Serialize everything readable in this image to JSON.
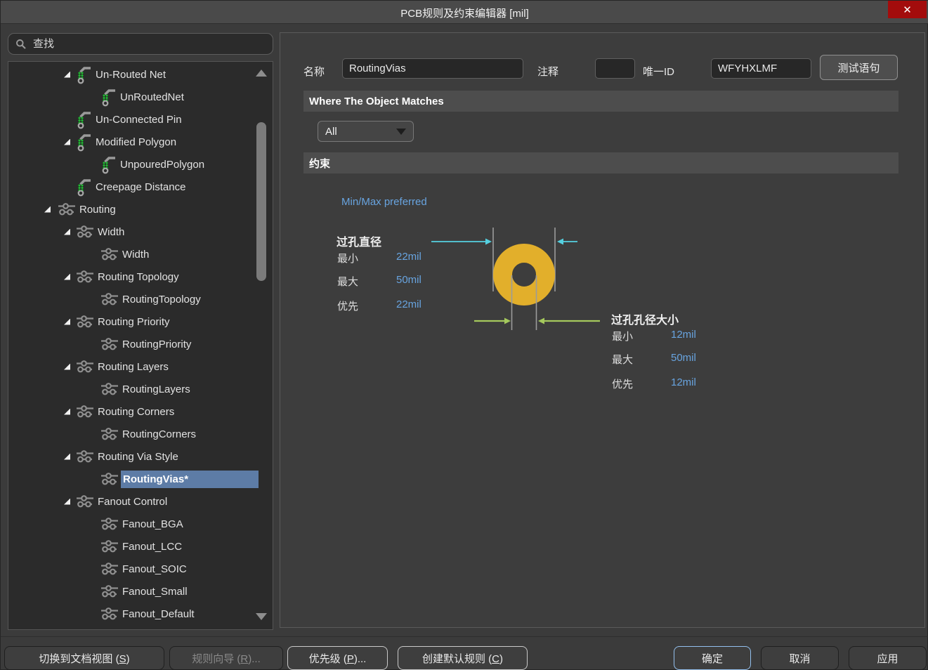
{
  "window": {
    "title": "PCB规则及约束编辑器 [mil]",
    "close_icon": "✕"
  },
  "search": {
    "placeholder": "查找"
  },
  "tree": {
    "items": [
      {
        "label": "Un-Routed Net",
        "level": 2,
        "icon": "electrical-rule-icon",
        "expander": true,
        "selected": false
      },
      {
        "label": "UnRoutedNet",
        "level": 3,
        "icon": "electrical-rule-icon",
        "expander": false,
        "selected": false
      },
      {
        "label": "Un-Connected Pin",
        "level": 2,
        "icon": "electrical-rule-icon",
        "expander": false,
        "selected": false
      },
      {
        "label": "Modified Polygon",
        "level": 2,
        "icon": "electrical-rule-icon",
        "expander": true,
        "selected": false
      },
      {
        "label": "UnpouredPolygon",
        "level": 3,
        "icon": "electrical-rule-icon",
        "expander": false,
        "selected": false
      },
      {
        "label": "Creepage Distance",
        "level": 2,
        "icon": "electrical-rule-icon",
        "expander": false,
        "selected": false
      },
      {
        "label": "Routing",
        "level": 1,
        "icon": "routing-rule-icon",
        "expander": true,
        "selected": false
      },
      {
        "label": "Width",
        "level": 2,
        "icon": "routing-rule-icon",
        "expander": true,
        "selected": false
      },
      {
        "label": "Width",
        "level": 3,
        "icon": "routing-rule-icon",
        "expander": false,
        "selected": false
      },
      {
        "label": "Routing Topology",
        "level": 2,
        "icon": "routing-rule-icon",
        "expander": true,
        "selected": false
      },
      {
        "label": "RoutingTopology",
        "level": 3,
        "icon": "routing-rule-icon",
        "expander": false,
        "selected": false
      },
      {
        "label": "Routing Priority",
        "level": 2,
        "icon": "routing-rule-icon",
        "expander": true,
        "selected": false
      },
      {
        "label": "RoutingPriority",
        "level": 3,
        "icon": "routing-rule-icon",
        "expander": false,
        "selected": false
      },
      {
        "label": "Routing Layers",
        "level": 2,
        "icon": "routing-rule-icon",
        "expander": true,
        "selected": false
      },
      {
        "label": "RoutingLayers",
        "level": 3,
        "icon": "routing-rule-icon",
        "expander": false,
        "selected": false
      },
      {
        "label": "Routing Corners",
        "level": 2,
        "icon": "routing-rule-icon",
        "expander": true,
        "selected": false
      },
      {
        "label": "RoutingCorners",
        "level": 3,
        "icon": "routing-rule-icon",
        "expander": false,
        "selected": false
      },
      {
        "label": "Routing Via Style",
        "level": 2,
        "icon": "routing-rule-icon",
        "expander": true,
        "selected": false
      },
      {
        "label": "RoutingVias*",
        "level": 3,
        "icon": "routing-rule-icon",
        "expander": false,
        "selected": true
      },
      {
        "label": "Fanout Control",
        "level": 2,
        "icon": "routing-rule-icon",
        "expander": true,
        "selected": false
      },
      {
        "label": "Fanout_BGA",
        "level": 3,
        "icon": "routing-rule-icon",
        "expander": false,
        "selected": false
      },
      {
        "label": "Fanout_LCC",
        "level": 3,
        "icon": "routing-rule-icon",
        "expander": false,
        "selected": false
      },
      {
        "label": "Fanout_SOIC",
        "level": 3,
        "icon": "routing-rule-icon",
        "expander": false,
        "selected": false
      },
      {
        "label": "Fanout_Small",
        "level": 3,
        "icon": "routing-rule-icon",
        "expander": false,
        "selected": false
      },
      {
        "label": "Fanout_Default",
        "level": 3,
        "icon": "routing-rule-icon",
        "expander": false,
        "selected": false
      }
    ]
  },
  "rule_header": {
    "name_label": "名称",
    "name_value": "RoutingVias",
    "comment_label": "注释",
    "comment_value": "",
    "uid_label": "唯一ID",
    "uid_value": "WFYHXLMF",
    "test_query_button": "测试语句"
  },
  "match_section": {
    "title": "Where The Object Matches",
    "scope_value": "All"
  },
  "constraints": {
    "title": "约束",
    "mode_note": "Min/Max preferred",
    "via_diameter": {
      "title": "过孔直径",
      "rows": [
        {
          "label": "最小",
          "value": "22mil"
        },
        {
          "label": "最大",
          "value": "50mil"
        },
        {
          "label": "优先",
          "value": "22mil"
        }
      ]
    },
    "hole_size": {
      "title": "过孔孔径大小",
      "rows": [
        {
          "label": "最小",
          "value": "12mil"
        },
        {
          "label": "最大",
          "value": "50mil"
        },
        {
          "label": "优先",
          "value": "12mil"
        }
      ]
    }
  },
  "footer": {
    "buttons": [
      {
        "pre": "切换到文档视图 (",
        "key": "S",
        "post": ")",
        "disabled": false,
        "style": "dark"
      },
      {
        "pre": "规则向导 (",
        "key": "R",
        "post": ")...",
        "disabled": true,
        "style": "dark"
      },
      {
        "pre": "优先级 (",
        "key": "P",
        "post": ")...",
        "disabled": false,
        "style": "light"
      },
      {
        "pre": "创建默认规则 (",
        "key": "C",
        "post": ")",
        "disabled": false,
        "style": "light"
      },
      {
        "pre": "确定",
        "key": "",
        "post": "",
        "disabled": false,
        "style": "primary"
      },
      {
        "pre": "取消",
        "key": "",
        "post": "",
        "disabled": false,
        "style": "dark"
      },
      {
        "pre": "应用",
        "key": "",
        "post": "",
        "disabled": false,
        "style": "dark"
      }
    ]
  },
  "colors": {
    "accent_blue_text": "#68a4e0",
    "selection_blue": "#5d7ca6",
    "via_pad_yellow": "#e2af2b",
    "diameter_arrow_cyan": "#55d0e0",
    "hole_arrow_green": "#a5c95d",
    "close_button_red": "#a30c0c",
    "ok_border_blue": "#93c0ee"
  }
}
